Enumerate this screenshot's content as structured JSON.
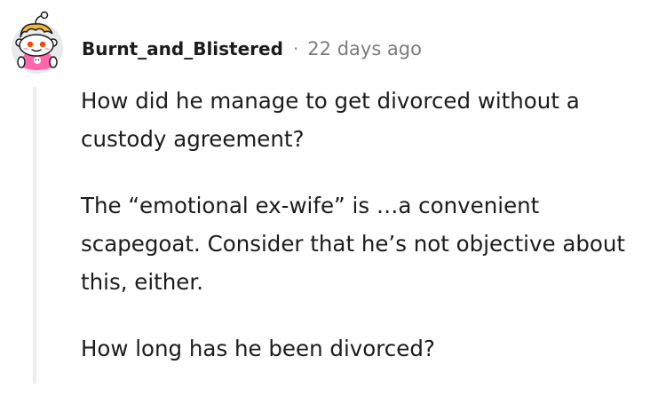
{
  "comment": {
    "author": "Burnt_and_Blistered",
    "separator": "·",
    "timestamp": "22 days ago",
    "avatar_icon": "snoo-avatar-icon",
    "paragraphs": [
      "How did he manage to get divorced without a custody agreement?",
      "The “emotional ex-wife” is …a convenient scapegoat. Consider that he’s not objective about this, either.",
      "How long has he been divorced?"
    ]
  },
  "colors": {
    "text": "#1c1c1c",
    "meta": "#7c7c7c",
    "thread_line": "#ededed",
    "avatar_bg": "#e9eaeb",
    "hair": "#f5b82e",
    "shirt": "#ff66ac"
  }
}
